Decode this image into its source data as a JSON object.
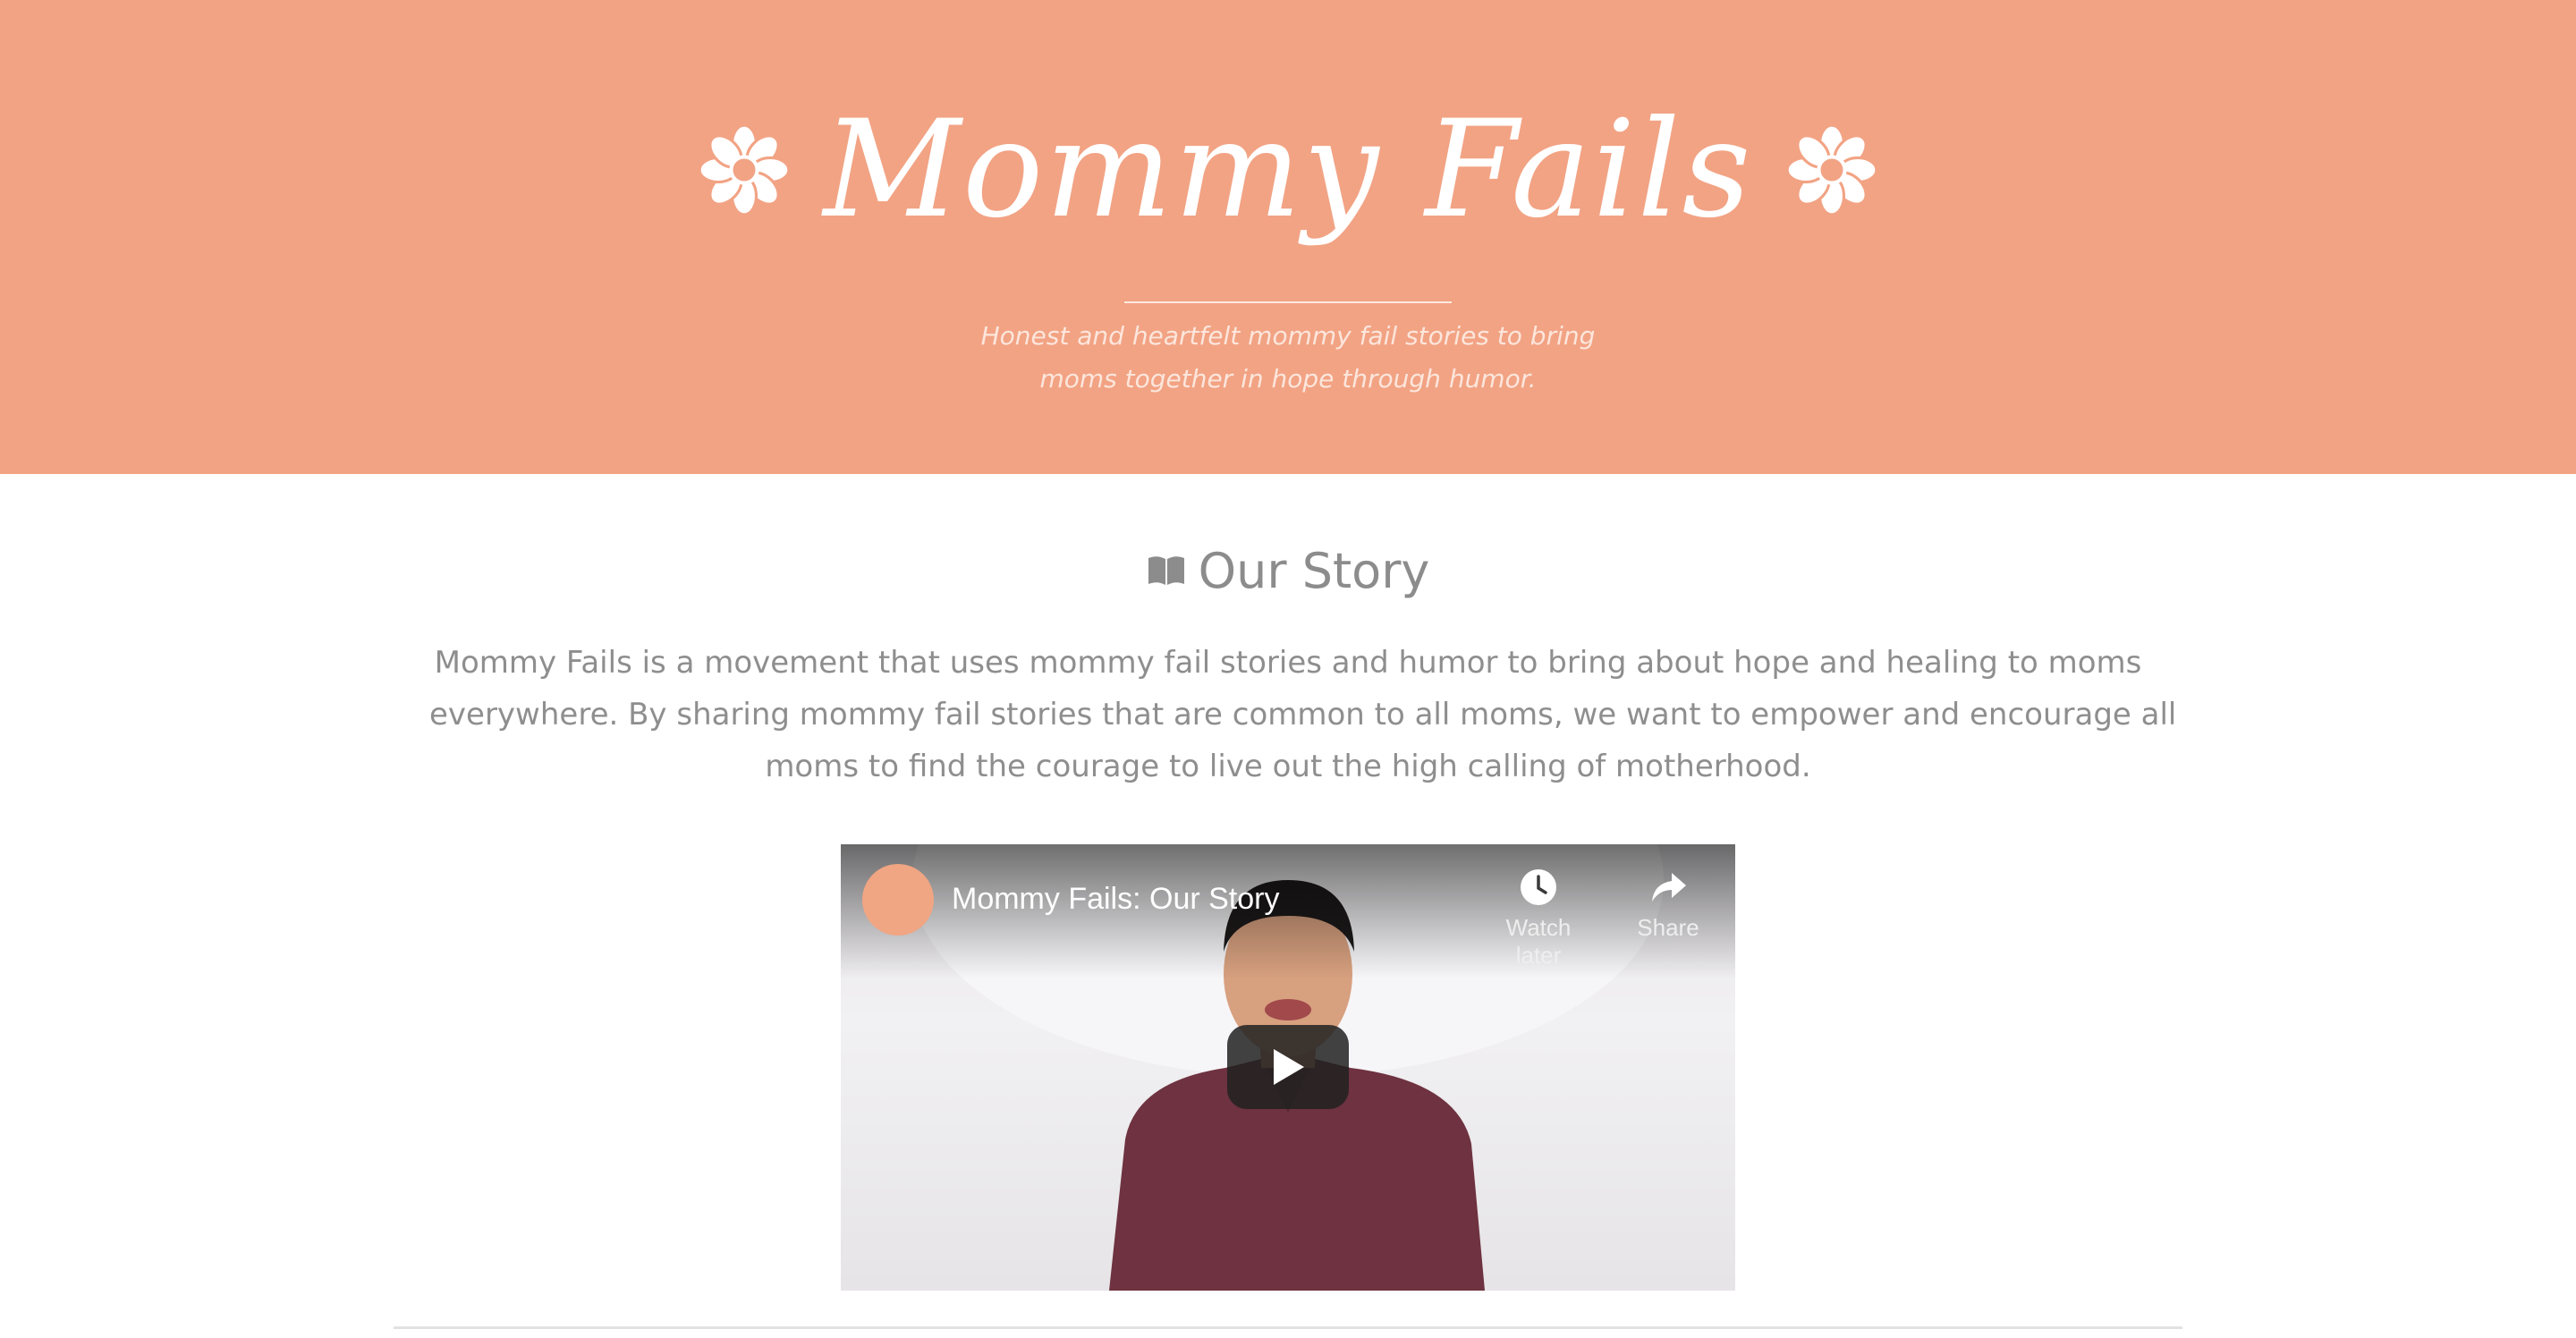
{
  "header": {
    "logo_text": "Mommy Fails",
    "tagline_line1": "Honest and heartfelt mommy fail stories to bring",
    "tagline_line2": "moms together in hope through humor."
  },
  "story_section": {
    "heading": "Our Story",
    "heading_icon": "book-icon",
    "paragraph_line1": "Mommy Fails is a movement that uses mommy fail stories and humor to bring about hope and healing to moms",
    "paragraph_line2": "everywhere. By sharing mommy fail stories that are common to all moms, we want to empower and encourage all",
    "paragraph_line3": "moms to find the courage to live out the high calling of motherhood."
  },
  "video": {
    "title": "Mommy Fails: Our Story",
    "watch_later_label": "Watch later",
    "share_label": "Share",
    "watch_later_icon": "clock-icon",
    "share_icon": "share-arrow-icon",
    "play_icon": "play-icon"
  },
  "colors": {
    "brand_peach": "#f2a384",
    "body_text": "#8e8e8e",
    "white": "#ffffff"
  }
}
